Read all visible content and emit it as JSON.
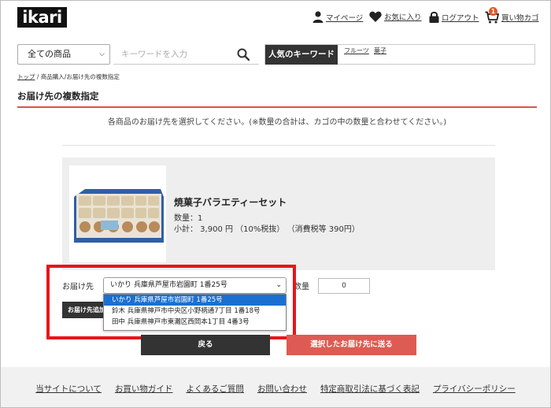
{
  "header": {
    "logo": "ikari",
    "mypage": "マイページ",
    "favorites": "お気に入り",
    "logout": "ログアウト",
    "cart": "買い物カゴ",
    "cart_count": "1"
  },
  "search": {
    "category": "全ての商品",
    "placeholder": "キーワードを入力",
    "popular_label": "人気のキーワード",
    "popular": [
      "フルーツ",
      "菓子"
    ]
  },
  "breadcrumb": {
    "home": "トップ",
    "sep": " / ",
    "current": "商品購入/お届け先の複数指定"
  },
  "page": {
    "title": "お届け先の複数指定",
    "instructions": "各商品のお届け先を選択してください。(※数量の合計は、カゴの中の数量と合わせてください。)"
  },
  "product": {
    "name": "焼菓子バラエティーセット",
    "quantity": "数量：1",
    "subtotal": "小計：  3,900 円 （10%税抜）  （消費税等 390円）"
  },
  "delivery": {
    "label": "お届け先",
    "selected": "いかり 兵庫県芦屋市岩園町 1番25号",
    "options": [
      "いかり 兵庫県芦屋市岩園町 1番25号",
      "鈴木 兵庫県神戸市中央区小野柄通7丁目 1番18号",
      "田中 兵庫県神戸市東灘区西岡本1丁目 4番3号"
    ],
    "qty_label": "数量",
    "qty_value": "0",
    "add_button": "お届け先追加"
  },
  "buttons": {
    "back": "戻る",
    "send": "選択したお届け先に送る"
  },
  "footer": {
    "links": [
      "当サイトについて",
      "お買い物ガイド",
      "よくあるご質問",
      "お問い合わせ",
      "特定商取引法に基づく表記",
      "プライバシーポリシー"
    ]
  },
  "colors": {
    "accent_red": "#d9534f",
    "send_button": "#dd5b52",
    "dark": "#333333",
    "highlight": "#e8141c",
    "option_selected": "#1a6fd1"
  }
}
